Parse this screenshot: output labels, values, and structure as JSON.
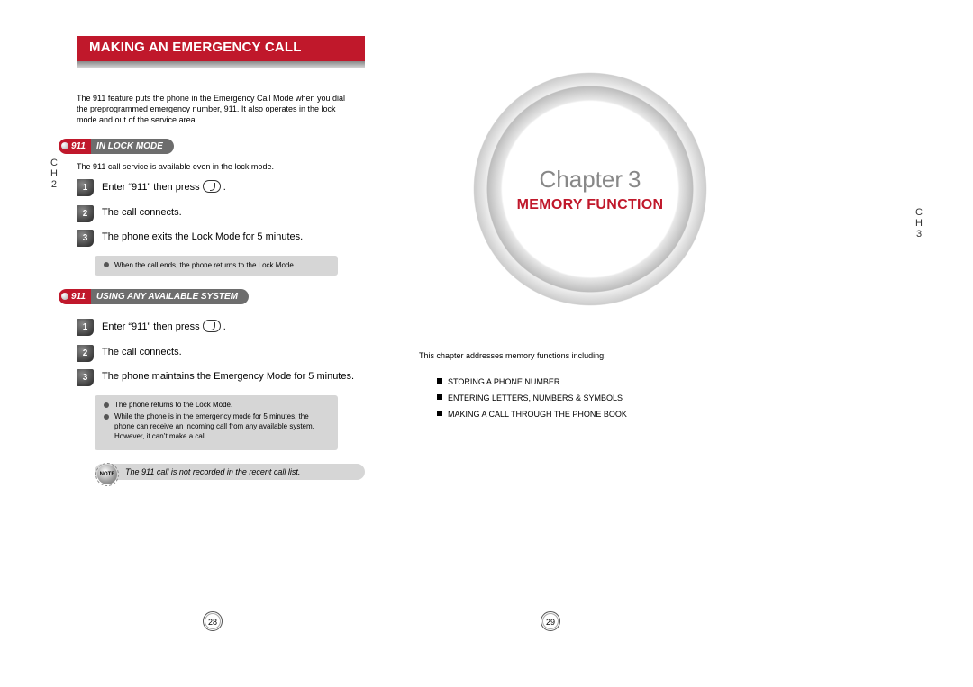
{
  "left": {
    "title": "MAKING AN EMERGENCY CALL",
    "intro": "The 911 feature puts the phone in the Emergency Call Mode when you dial the preprogrammed emergency number, 911. It also operates in the lock mode and out of the service area.",
    "ch_marker": {
      "line1": "C",
      "line2": "H",
      "line3": "2"
    },
    "section1": {
      "prefix": "911",
      "label": "IN LOCK MODE",
      "intro": "The 911 call service is available even in the lock mode.",
      "steps": [
        "Enter “911” then press",
        "The call connects.",
        "The phone exits the Lock Mode for 5 minutes."
      ],
      "note_items": [
        "When the call ends, the phone returns to the Lock Mode."
      ]
    },
    "section2": {
      "prefix": "911",
      "label": "USING ANY AVAILABLE SYSTEM",
      "steps": [
        "Enter “911” then press",
        "The call connects.",
        "The phone maintains the Emergency Mode for 5 minutes."
      ],
      "note_items": [
        "The phone returns to the Lock Mode.",
        "While the phone is in the emergency mode for 5 minutes, the phone can receive an incoming call from any available system. However, it can’t make a call."
      ]
    },
    "footnote_badge": "NOTE",
    "footnote": "The 911 call is not recorded in the recent call list.",
    "page_num": "28"
  },
  "right": {
    "chapter_label": "Chapter",
    "chapter_num": "3",
    "chapter_title": "MEMORY FUNCTION",
    "ch_marker": {
      "line1": "C",
      "line2": "H",
      "line3": "3"
    },
    "intro": "This chapter addresses memory functions including:",
    "toc": [
      "STORING A PHONE NUMBER",
      "ENTERING LETTERS, NUMBERS & SYMBOLS",
      "MAKING A CALL THROUGH THE PHONE BOOK"
    ],
    "page_num": "29"
  }
}
